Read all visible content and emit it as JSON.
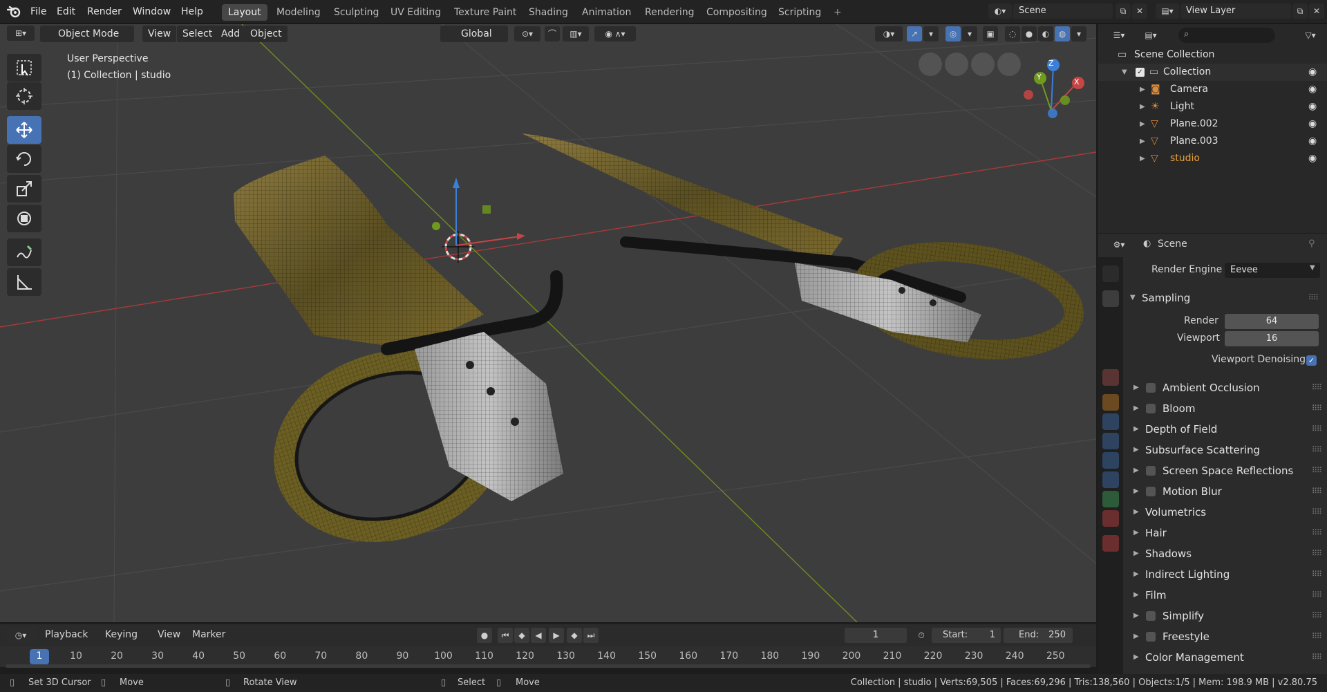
{
  "topbar": {
    "menus": [
      "File",
      "Edit",
      "Render",
      "Window",
      "Help"
    ],
    "workspaces": [
      "Layout",
      "Modeling",
      "Sculpting",
      "UV Editing",
      "Texture Paint",
      "Shading",
      "Animation",
      "Rendering",
      "Compositing",
      "Scripting"
    ],
    "active_workspace": "Layout",
    "add_workspace": "+",
    "scene_name": "Scene",
    "view_layer_name": "View Layer"
  },
  "viewport": {
    "mode": "Object Mode",
    "menus": [
      "View",
      "Select",
      "Add",
      "Object"
    ],
    "transform_orientation": "Global",
    "perspective_label": "User Perspective",
    "collection_label": "(1) Collection | studio",
    "gizmo_axes": [
      "X",
      "Y",
      "Z"
    ],
    "colors": {
      "x_axis": "#c64545",
      "y_axis": "#6f9a1d",
      "z_axis": "#3c7fd8",
      "background": "#3d3d3d"
    }
  },
  "tools": [
    "select-box",
    "cursor",
    "move",
    "rotate",
    "scale",
    "transform",
    "annotate",
    "measure"
  ],
  "timeline": {
    "menus": [
      "Playback",
      "Keying",
      "View",
      "Marker"
    ],
    "current_frame": "1",
    "start_label": "Start:",
    "start": "1",
    "end_label": "End:",
    "end": "250",
    "ruler": [
      "1",
      "10",
      "20",
      "30",
      "40",
      "50",
      "60",
      "70",
      "80",
      "90",
      "100",
      "110",
      "120",
      "130",
      "140",
      "150",
      "160",
      "170",
      "180",
      "190",
      "200",
      "210",
      "220",
      "230",
      "240",
      "250"
    ]
  },
  "outliner": {
    "root": "Scene Collection",
    "collection": "Collection",
    "items": [
      {
        "name": "Camera",
        "icon": "camera-icon"
      },
      {
        "name": "Light",
        "icon": "light-icon"
      },
      {
        "name": "Plane.002",
        "icon": "mesh-icon"
      },
      {
        "name": "Plane.003",
        "icon": "mesh-icon"
      },
      {
        "name": "studio",
        "icon": "mesh-icon"
      }
    ]
  },
  "properties": {
    "context": "Scene",
    "render_engine_label": "Render Engine",
    "render_engine": "Eevee",
    "sampling_label": "Sampling",
    "render_label": "Render",
    "render_samples": "64",
    "viewport_label": "Viewport",
    "viewport_samples": "16",
    "viewport_denoising_label": "Viewport Denoising",
    "sections": [
      {
        "label": "Ambient Occlusion",
        "checkbox": true
      },
      {
        "label": "Bloom",
        "checkbox": true
      },
      {
        "label": "Depth of Field",
        "checkbox": false
      },
      {
        "label": "Subsurface Scattering",
        "checkbox": false
      },
      {
        "label": "Screen Space Reflections",
        "checkbox": true
      },
      {
        "label": "Motion Blur",
        "checkbox": true
      },
      {
        "label": "Volumetrics",
        "checkbox": false
      },
      {
        "label": "Hair",
        "checkbox": false
      },
      {
        "label": "Shadows",
        "checkbox": false
      },
      {
        "label": "Indirect Lighting",
        "checkbox": false
      },
      {
        "label": "Film",
        "checkbox": false
      },
      {
        "label": "Simplify",
        "checkbox": true
      },
      {
        "label": "Freestyle",
        "checkbox": true
      },
      {
        "label": "Color Management",
        "checkbox": false
      }
    ]
  },
  "statusbar": {
    "set_cursor": "Set 3D Cursor",
    "move": "Move",
    "rotate_view": "Rotate View",
    "select": "Select",
    "move2": "Move",
    "stats": "Collection | studio | Verts:69,505 | Faces:69,296 | Tris:138,560 | Objects:1/5 | Mem: 198.9 MB | v2.80.75"
  }
}
